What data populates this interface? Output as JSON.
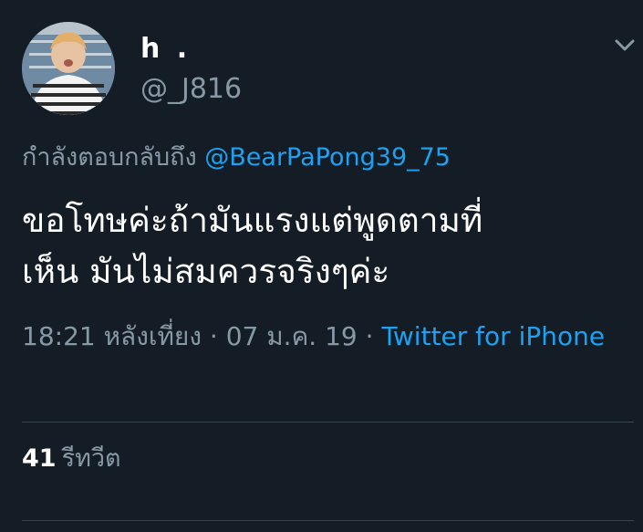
{
  "tweet": {
    "display_name": "h .",
    "handle": "@_J816",
    "reply_prefix": "กำลังตอบกลับถึง ",
    "reply_to": "@BearPaPong39_75",
    "text_line1": "ขอโทษค่ะถ้ามันแรงแต่พูดตามที่",
    "text_line2": "เห็น มันไม่สมควรจริงๆค่ะ",
    "time": "18:21 หลังเที่ยง",
    "separator1": " · ",
    "date": "07 ม.ค. 19",
    "separator2": " · ",
    "source": "Twitter for iPhone"
  },
  "stats": {
    "retweet_count": "41",
    "retweet_label": "รีทวีต"
  },
  "icons": {
    "menu": "chevron-down-icon"
  },
  "colors": {
    "background": "#141d26",
    "link": "#1da1f2",
    "secondary_text": "#8899a6"
  }
}
